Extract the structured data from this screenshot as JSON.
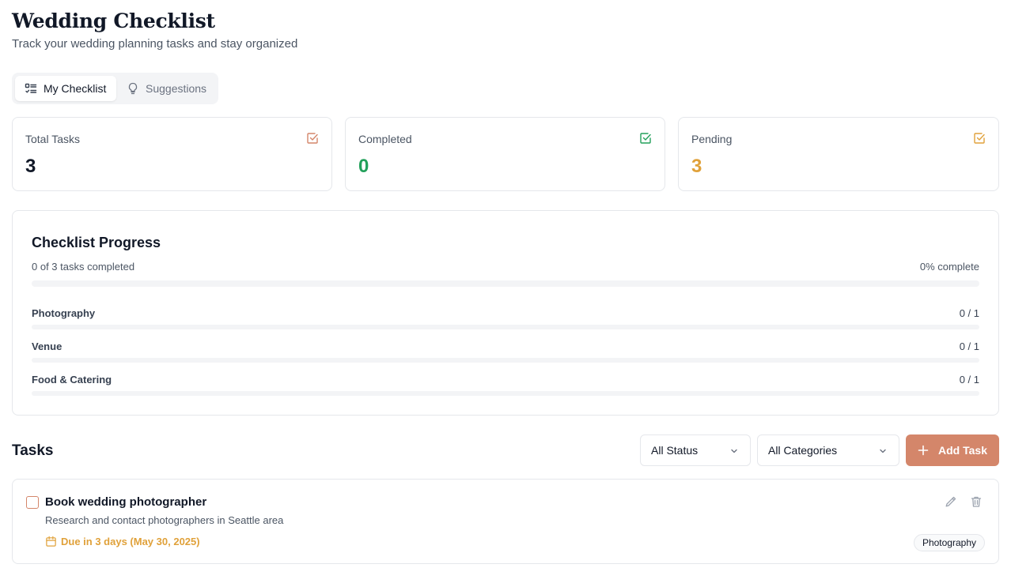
{
  "header": {
    "title": "Wedding Checklist",
    "subtitle": "Track your wedding planning tasks and stay organized"
  },
  "tabs": [
    {
      "label": "My Checklist",
      "icon": "list-check-icon",
      "active": true
    },
    {
      "label": "Suggestions",
      "icon": "lightbulb-icon",
      "active": false
    }
  ],
  "stats": [
    {
      "label": "Total Tasks",
      "value": "3",
      "color": "#111827",
      "icon_color": "#d4866a",
      "icon": "checkbox-icon"
    },
    {
      "label": "Completed",
      "value": "0",
      "color": "#22a05a",
      "icon_color": "#22a05a",
      "icon": "checkbox-icon"
    },
    {
      "label": "Pending",
      "value": "3",
      "color": "#e0a13a",
      "icon_color": "#e0a13a",
      "icon": "checkbox-icon"
    }
  ],
  "progress": {
    "title": "Checklist Progress",
    "summary": "0 of 3 tasks completed",
    "percent_label": "0% complete",
    "fraction": 0,
    "categories": [
      {
        "name": "Photography",
        "count": "0 / 1",
        "fraction": 0
      },
      {
        "name": "Venue",
        "count": "0 / 1",
        "fraction": 0
      },
      {
        "name": "Food & Catering",
        "count": "0 / 1",
        "fraction": 0
      }
    ]
  },
  "tasks_section": {
    "title": "Tasks",
    "status_filter": "All Status",
    "category_filter": "All Categories",
    "add_label": "Add Task"
  },
  "tasks": [
    {
      "title": "Book wedding photographer",
      "description": "Research and contact photographers in Seattle area",
      "due": "Due in 3 days (May 30, 2025)",
      "category": "Photography",
      "completed": false
    }
  ],
  "colors": {
    "accent": "#d4866a",
    "success": "#22a05a",
    "warning": "#e0a13a"
  }
}
